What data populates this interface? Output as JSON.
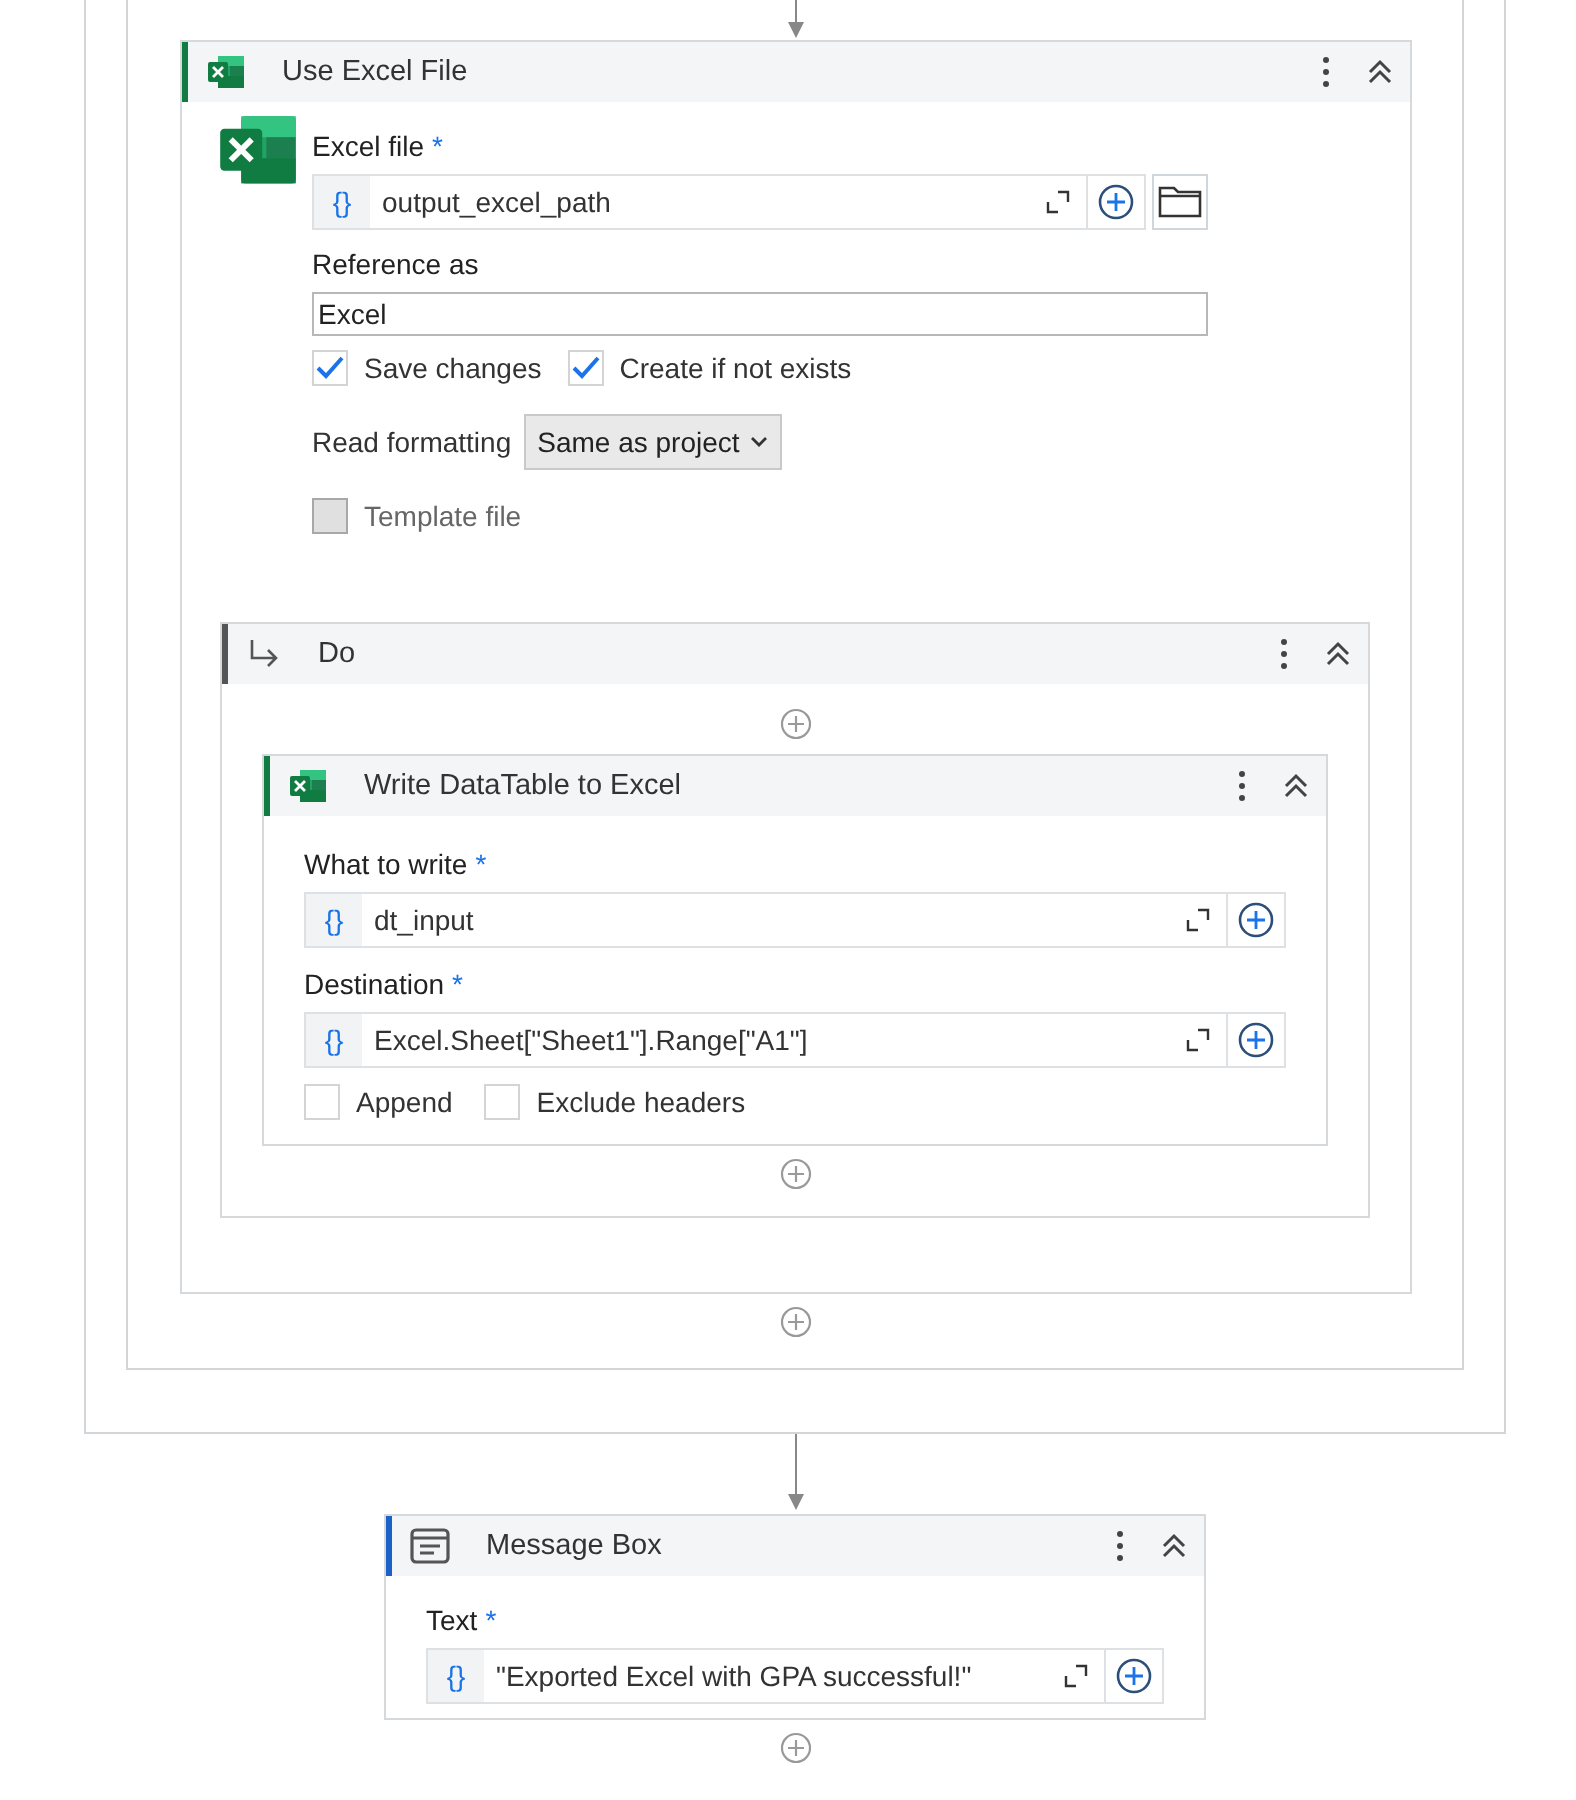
{
  "use_excel_file": {
    "title": "Use Excel File",
    "excel_file": {
      "kind": "expression",
      "label": "Excel file",
      "required_mark": "*",
      "prefix": "{}",
      "value": "output_excel_path",
      "browse": true
    },
    "reference_as": {
      "kind": "text",
      "label": "Reference as",
      "value": "Excel"
    },
    "options": [
      {
        "label": "Save changes",
        "checked": true
      },
      {
        "label": "Create if not exists",
        "checked": true
      }
    ],
    "read_formatting": {
      "label": "Read formatting",
      "value": "Same as project"
    },
    "template_file": {
      "label": "Template file",
      "checked": false,
      "disabled": true
    },
    "do": {
      "title": "Do",
      "activity": {
        "title": "Write DataTable to Excel",
        "fields": [
          {
            "kind": "expression",
            "label": "What to write",
            "required_mark": "*",
            "prefix": "{}",
            "value": "dt_input"
          },
          {
            "kind": "expression",
            "label": "Destination",
            "required_mark": "*",
            "prefix": "{}",
            "value": "Excel.Sheet[\"Sheet1\"].Range[\"A1\"]"
          }
        ],
        "options": [
          {
            "label": "Append",
            "checked": false
          },
          {
            "label": "Exclude headers",
            "checked": false
          }
        ]
      }
    }
  },
  "message_box": {
    "title": "Message Box",
    "field": {
      "kind": "expression",
      "label": "Text",
      "required_mark": "*",
      "prefix": "{}",
      "value": "\"Exported Excel with GPA successful!\""
    }
  }
}
